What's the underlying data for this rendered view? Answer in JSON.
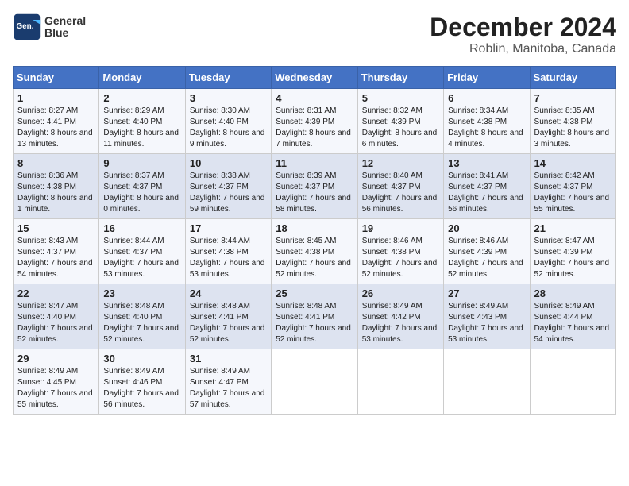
{
  "header": {
    "logo_line1": "General",
    "logo_line2": "Blue",
    "month": "December 2024",
    "location": "Roblin, Manitoba, Canada"
  },
  "days_of_week": [
    "Sunday",
    "Monday",
    "Tuesday",
    "Wednesday",
    "Thursday",
    "Friday",
    "Saturday"
  ],
  "weeks": [
    [
      {
        "day": "1",
        "sunrise": "8:27 AM",
        "sunset": "4:41 PM",
        "daylight": "8 hours and 13 minutes."
      },
      {
        "day": "2",
        "sunrise": "8:29 AM",
        "sunset": "4:40 PM",
        "daylight": "8 hours and 11 minutes."
      },
      {
        "day": "3",
        "sunrise": "8:30 AM",
        "sunset": "4:40 PM",
        "daylight": "8 hours and 9 minutes."
      },
      {
        "day": "4",
        "sunrise": "8:31 AM",
        "sunset": "4:39 PM",
        "daylight": "8 hours and 7 minutes."
      },
      {
        "day": "5",
        "sunrise": "8:32 AM",
        "sunset": "4:39 PM",
        "daylight": "8 hours and 6 minutes."
      },
      {
        "day": "6",
        "sunrise": "8:34 AM",
        "sunset": "4:38 PM",
        "daylight": "8 hours and 4 minutes."
      },
      {
        "day": "7",
        "sunrise": "8:35 AM",
        "sunset": "4:38 PM",
        "daylight": "8 hours and 3 minutes."
      }
    ],
    [
      {
        "day": "8",
        "sunrise": "8:36 AM",
        "sunset": "4:38 PM",
        "daylight": "8 hours and 1 minute."
      },
      {
        "day": "9",
        "sunrise": "8:37 AM",
        "sunset": "4:37 PM",
        "daylight": "8 hours and 0 minutes."
      },
      {
        "day": "10",
        "sunrise": "8:38 AM",
        "sunset": "4:37 PM",
        "daylight": "7 hours and 59 minutes."
      },
      {
        "day": "11",
        "sunrise": "8:39 AM",
        "sunset": "4:37 PM",
        "daylight": "7 hours and 58 minutes."
      },
      {
        "day": "12",
        "sunrise": "8:40 AM",
        "sunset": "4:37 PM",
        "daylight": "7 hours and 56 minutes."
      },
      {
        "day": "13",
        "sunrise": "8:41 AM",
        "sunset": "4:37 PM",
        "daylight": "7 hours and 56 minutes."
      },
      {
        "day": "14",
        "sunrise": "8:42 AM",
        "sunset": "4:37 PM",
        "daylight": "7 hours and 55 minutes."
      }
    ],
    [
      {
        "day": "15",
        "sunrise": "8:43 AM",
        "sunset": "4:37 PM",
        "daylight": "7 hours and 54 minutes."
      },
      {
        "day": "16",
        "sunrise": "8:44 AM",
        "sunset": "4:37 PM",
        "daylight": "7 hours and 53 minutes."
      },
      {
        "day": "17",
        "sunrise": "8:44 AM",
        "sunset": "4:38 PM",
        "daylight": "7 hours and 53 minutes."
      },
      {
        "day": "18",
        "sunrise": "8:45 AM",
        "sunset": "4:38 PM",
        "daylight": "7 hours and 52 minutes."
      },
      {
        "day": "19",
        "sunrise": "8:46 AM",
        "sunset": "4:38 PM",
        "daylight": "7 hours and 52 minutes."
      },
      {
        "day": "20",
        "sunrise": "8:46 AM",
        "sunset": "4:39 PM",
        "daylight": "7 hours and 52 minutes."
      },
      {
        "day": "21",
        "sunrise": "8:47 AM",
        "sunset": "4:39 PM",
        "daylight": "7 hours and 52 minutes."
      }
    ],
    [
      {
        "day": "22",
        "sunrise": "8:47 AM",
        "sunset": "4:40 PM",
        "daylight": "7 hours and 52 minutes."
      },
      {
        "day": "23",
        "sunrise": "8:48 AM",
        "sunset": "4:40 PM",
        "daylight": "7 hours and 52 minutes."
      },
      {
        "day": "24",
        "sunrise": "8:48 AM",
        "sunset": "4:41 PM",
        "daylight": "7 hours and 52 minutes."
      },
      {
        "day": "25",
        "sunrise": "8:48 AM",
        "sunset": "4:41 PM",
        "daylight": "7 hours and 52 minutes."
      },
      {
        "day": "26",
        "sunrise": "8:49 AM",
        "sunset": "4:42 PM",
        "daylight": "7 hours and 53 minutes."
      },
      {
        "day": "27",
        "sunrise": "8:49 AM",
        "sunset": "4:43 PM",
        "daylight": "7 hours and 53 minutes."
      },
      {
        "day": "28",
        "sunrise": "8:49 AM",
        "sunset": "4:44 PM",
        "daylight": "7 hours and 54 minutes."
      }
    ],
    [
      {
        "day": "29",
        "sunrise": "8:49 AM",
        "sunset": "4:45 PM",
        "daylight": "7 hours and 55 minutes."
      },
      {
        "day": "30",
        "sunrise": "8:49 AM",
        "sunset": "4:46 PM",
        "daylight": "7 hours and 56 minutes."
      },
      {
        "day": "31",
        "sunrise": "8:49 AM",
        "sunset": "4:47 PM",
        "daylight": "7 hours and 57 minutes."
      },
      null,
      null,
      null,
      null
    ]
  ]
}
